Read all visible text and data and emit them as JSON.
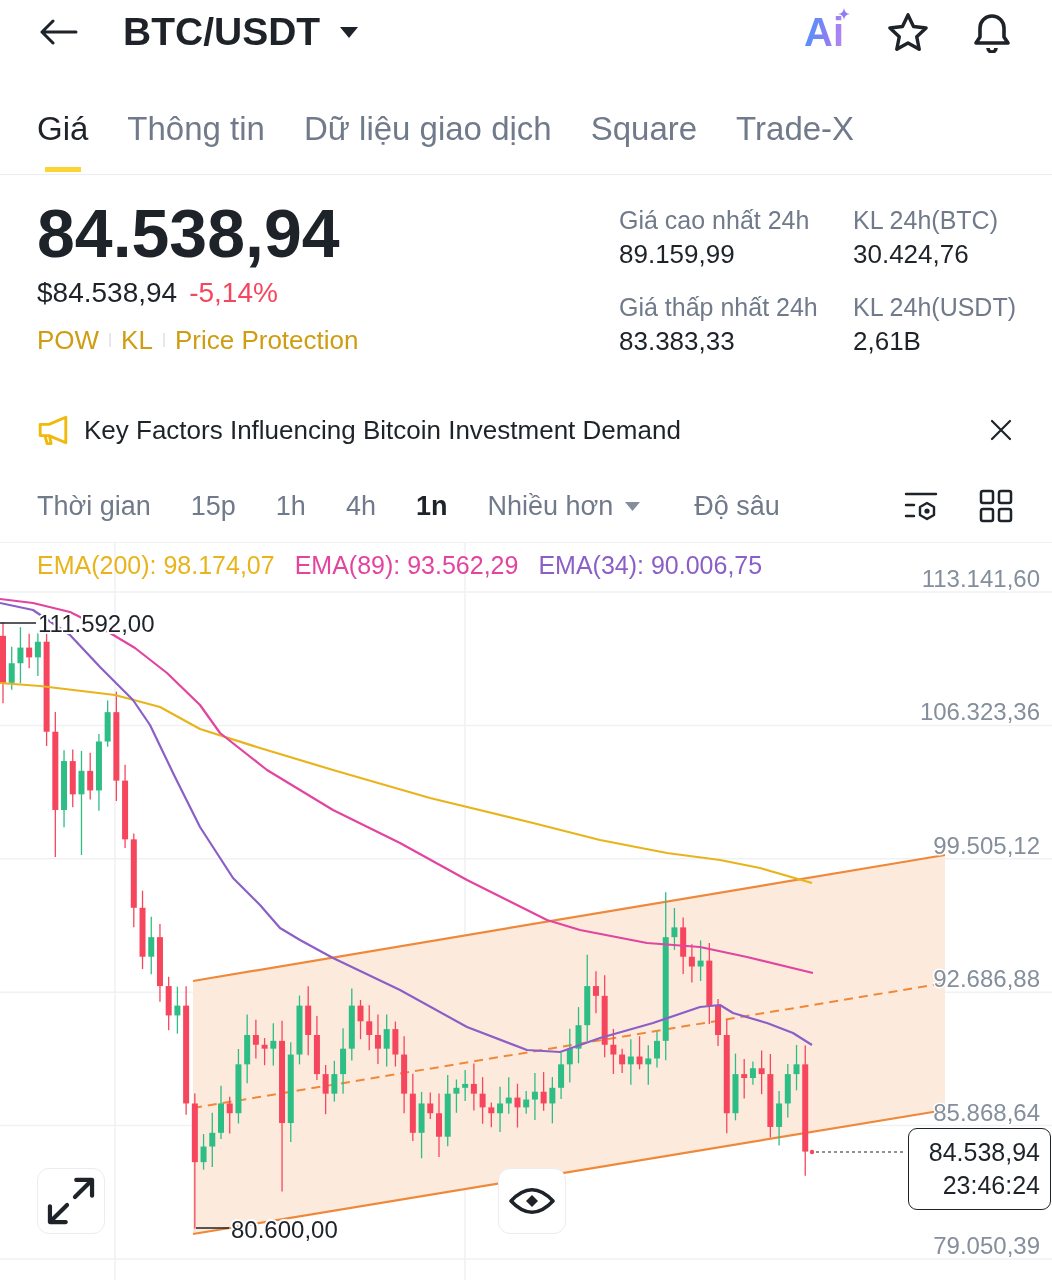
{
  "header": {
    "pair": "BTC/USDT",
    "ai_label": "Ai"
  },
  "tabs": [
    {
      "label": "Giá",
      "selected": true
    },
    {
      "label": "Thông tin",
      "selected": false
    },
    {
      "label": "Dữ liệu giao dịch",
      "selected": false
    },
    {
      "label": "Square",
      "selected": false
    },
    {
      "label": "Trade-X",
      "selected": false
    }
  ],
  "price": {
    "last": "84.538,94",
    "usd": "$84.538,94",
    "change": "-5,14%",
    "tags": [
      "POW",
      "KL",
      "Price Protection"
    ]
  },
  "stats": [
    {
      "label": "Giá cao nhất 24h",
      "value": "89.159,99"
    },
    {
      "label": "KL 24h(BTC)",
      "value": "30.424,76"
    },
    {
      "label": "Giá thấp nhất 24h",
      "value": "83.383,33"
    },
    {
      "label": "KL 24h(USDT)",
      "value": "2,61B"
    }
  ],
  "banner": {
    "text": "Key Factors Influencing Bitcoin Investment Demand"
  },
  "intervals": [
    {
      "label": "Thời gian",
      "kind": "option",
      "selected": false
    },
    {
      "label": "15p",
      "kind": "option",
      "selected": false
    },
    {
      "label": "1h",
      "kind": "option",
      "selected": false
    },
    {
      "label": "4h",
      "kind": "option",
      "selected": false
    },
    {
      "label": "1n",
      "kind": "option",
      "selected": true
    },
    {
      "label": "Nhiều hơn",
      "kind": "dropdown",
      "selected": false
    },
    {
      "label": "Độ sâu",
      "kind": "option",
      "selected": false
    }
  ],
  "chart": {
    "indicators": [
      {
        "label": "EMA(200): 98.174,07",
        "color": "#e9b41b"
      },
      {
        "label": "EMA(89): 93.562,29",
        "color": "#e2449f"
      },
      {
        "label": "EMA(34): 90.006,75",
        "color": "#8b5fc6"
      }
    ],
    "price_axis": [
      "113.141,60",
      "106.323,36",
      "99.505,12",
      "92.686,88",
      "85.868,64",
      "79.050,39"
    ],
    "high_label": "111.592,00",
    "low_label": "80.600,00",
    "last_price": "84.538,94",
    "countdown": "23:46:24"
  }
}
